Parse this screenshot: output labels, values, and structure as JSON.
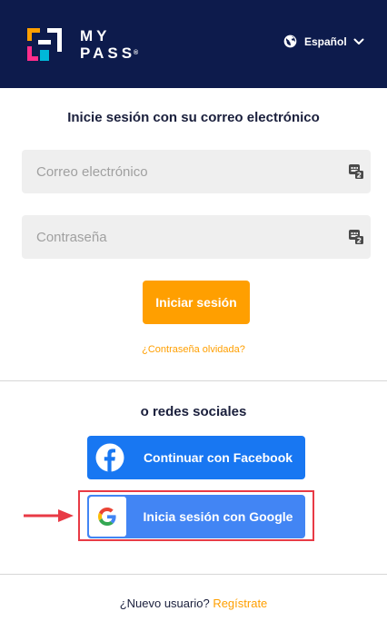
{
  "header": {
    "logo_text_line1": "MY",
    "logo_text_line2": "PASS",
    "logo_reg": "®",
    "language_label": "Español",
    "background_color": "#0d1b4c"
  },
  "login": {
    "title": "Inicie sesión con su correo electrónico",
    "email_placeholder": "Correo electrónico",
    "email_value": "",
    "password_placeholder": "Contraseña",
    "password_value": "",
    "submit_label": "Iniciar sesión",
    "forgot_label": "¿Contraseña olvidada?",
    "accent_color": "#ff9f00"
  },
  "social": {
    "title": "o redes sociales",
    "facebook_label": "Continuar con Facebook",
    "google_label": "Inicia sesión con Google",
    "facebook_color": "#1877f2",
    "google_color": "#4285f4",
    "highlight_color": "#e83a45"
  },
  "footer": {
    "question": "¿Nuevo usuario?",
    "register_label": "Regístrate"
  },
  "icons": {
    "logo": "mypass-logo-icon",
    "language": "globe-icon",
    "dropdown": "chevron-down-icon",
    "field_key": "password-manager-key-icon",
    "facebook": "facebook-icon",
    "google": "google-icon",
    "annotation": "red-arrow-icon"
  }
}
